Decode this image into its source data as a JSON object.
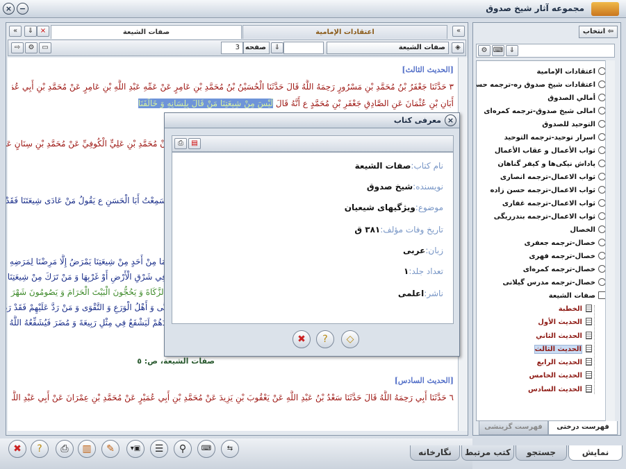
{
  "window": {
    "title": "مجموعه آثار شیخ صدوق"
  },
  "left_panel": {
    "tab_active": "صفات الشيعة",
    "tab_inactive": "اعتقادات الإمامية",
    "book_combo": "صفات الشيعة",
    "page_label": "صفحه",
    "page_value": "3",
    "status_line": "صفات الشيعة، ص: ٥",
    "content": [
      {
        "type": "heading",
        "text": "[الحديث الثالث]"
      },
      {
        "type": "red",
        "text": "٣ حَدَّثَنَا جَعْفَرُ بْنُ مُحَمَّدِ بْنِ مَسْرُورٍ رَحِمَهُ اللَّهُ قَالَ حَدَّثَنَا الْحُسَيْنُ بْنُ مُحَمَّدِ بْنِ عَامِرٍ عَنْ عَمِّهِ عَبْدِ اللَّهِ بْنِ عَامِرٍ عَنْ مُحَمَّدِ بْنِ أَبِي عُمَيْرٍ عَنْ"
      },
      {
        "type": "red_hl",
        "text": "أَبَانِ بْنِ عُثْمَانَ عَنِ الصَّادِقِ جَعْفَرِ بْنِ مُحَمَّدٍ ع أَنَّهُ قَالَ",
        "hl": "لَيْسَ مِنْ شِيعَتِنَا مَنْ قَالَ بِلِسَانِهِ وَ خَالَفَنَا"
      },
      {
        "type": "red",
        "text": "نْ مُحَمَّدِ بْنِ عَلِيٍّ الْكُوفِيِّ عَنْ مُحَمَّدِ بْنِ سِنَانٍ عَنِ"
      },
      {
        "type": "blue",
        "text": "سَمِعْتُ أَبَا الْحَسَنِ ع يَقُولُ مَنْ عَادَى شِيعَتَنَا فَقَدْ"
      },
      {
        "type": "blue",
        "text": "مَا مِنْ أَحَدٍ مِنْ شِيعَتِنَا يَمْرَضُ إِلَّا مَرِضْنَا لِمَرَضِهِ"
      },
      {
        "type": "blue",
        "text": "فِي شَرْقِ الْأَرْضِ أَوْ غَرْبِهَا وَ مَنْ تَرَكَ مِنْ شِيعَتِنَا"
      },
      {
        "type": "green",
        "text": "الزَّكَاةَ وَ يَحُجُّونَ الْبَيْتَ الْحَرَامَ وَ يَصُومُونَ شَهْرَ"
      },
      {
        "type": "blue",
        "text": "نَّى وَ أَهْلُ الْوَرَعِ وَ التَّقْوَى وَ مَنْ رَدَّ عَلَيْهِمْ فَقَدْ رَدَّ"
      },
      {
        "type": "blue",
        "text": "دَهُمْ لَيَشْفَعُ فِي مِثْلِ رَبِيعَةَ وَ مُضَرَ فَيُشَفِّعُهُ اللَّهُ"
      },
      {
        "type": "heading",
        "text": "[الحديث السادس]"
      },
      {
        "type": "red",
        "text": "٦ حَدَّثَنَا أَبِي رَحِمَهُ اللَّهُ قَالَ حَدَّثَنَا سَعْدُ بْنُ عَبْدِ اللَّهِ عَنْ يَعْقُوبَ بْنِ يَزِيدَ عَنْ مُحَمَّدِ بْنِ أَبِي عُمَيْرٍ عَنْ مُحَمَّدِ بْنِ عِمْرَانَ عَنْ أَبِي عَبْدِ اللَّهِ ع قَالَ"
      }
    ]
  },
  "dialog": {
    "title": "معرفی کتاب",
    "fields": [
      {
        "label": "نام کتاب:",
        "value": "صفات الشيعة"
      },
      {
        "label": "نویسنده:",
        "value": "شیخ صدوق"
      },
      {
        "label": "موضوع:",
        "value": "ویژگیهای شیعیان"
      },
      {
        "label": "تاریخ وفات مؤلف:",
        "value": "۳۸۱ ق"
      },
      {
        "label": "زبان:",
        "value": "عربی"
      },
      {
        "label": "تعداد جلد:",
        "value": "۱"
      },
      {
        "label": "ناشر:",
        "value": "اعلمی"
      }
    ]
  },
  "right_panel": {
    "select_button": "انتخاب",
    "tree": [
      "اعتقادات الإمامية",
      "اعتقادات شیخ صدوق ره-ترجمه حسنی",
      "أمالي الصدوق",
      "امالی شیخ صدوق-ترجمه کمره‌ای",
      "التوحيد للصدوق",
      "اسرار توحید-ترجمه التوحيد",
      "ثواب الأعمال و عقاب الأعمال",
      "پاداش نیکی‌ها و کیفر گناهان",
      "ثواب الاعمال-ترجمه انصاری",
      "ثواب الاعمال-ترجمه حسن زاده",
      "ثواب الاعمال-ترجمه غفاری",
      "ثواب الاعمال-ترجمه بندرریگی",
      "الخصال",
      "خصال-ترجمه جعفری",
      "خصال-ترجمه فهری",
      "خصال-ترجمه کمره‌ای",
      "خصال-ترجمه مدرس گیلانی",
      "صفات الشيعة"
    ],
    "subtree": [
      "الخطبة",
      "الحديث الأول",
      "الحديث الثاني",
      "الحديث الثالث",
      "الحديث الرابع",
      "الحديث الخامس",
      "الحديث السادس"
    ],
    "tab_tree": "فهرست درختی",
    "tab_index": "فهرست گزینشی"
  },
  "bottom_tabs": [
    "نمایش",
    "جستجو",
    "کتب مرتبط",
    "نگارخانه"
  ]
}
